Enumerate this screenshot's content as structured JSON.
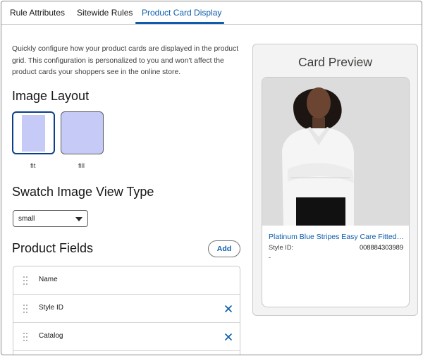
{
  "tabs": [
    {
      "label": "Rule Attributes"
    },
    {
      "label": "Sitewide Rules"
    },
    {
      "label": "Product Card Display"
    }
  ],
  "description": "Quickly configure how your product cards are displayed in the product grid. This configuration is personalized to you and won't affect the product cards your shoppers see in the online store.",
  "image_layout": {
    "title": "Image Layout",
    "options": [
      {
        "label": "fit",
        "selected": true
      },
      {
        "label": "fill",
        "selected": false
      }
    ]
  },
  "swatch": {
    "title": "Swatch Image View Type",
    "selected": "small"
  },
  "product_fields": {
    "title": "Product Fields",
    "add_label": "Add",
    "items": [
      {
        "name": "Name",
        "removable": false
      },
      {
        "name": "Style ID",
        "removable": true
      },
      {
        "name": "Catalog",
        "removable": true
      }
    ]
  },
  "preview": {
    "title": "Card Preview",
    "product_name": "Platinum Blue Stripes Easy Care Fitted Shirt",
    "field_label": "Style ID:",
    "field_value": "008884303989",
    "extra": "-"
  },
  "colors": {
    "accent": "#0b5cab",
    "layout_swatch": "#c5cbf6"
  }
}
